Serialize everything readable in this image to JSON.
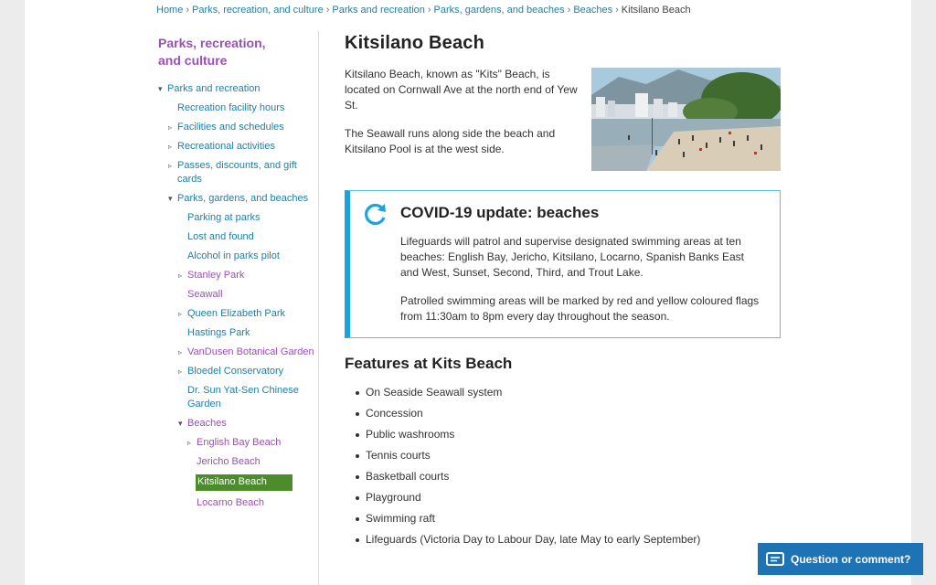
{
  "breadcrumb": [
    {
      "label": "Home",
      "link": true
    },
    {
      "label": "Parks, recreation, and culture",
      "link": true
    },
    {
      "label": "Parks and recreation",
      "link": true
    },
    {
      "label": "Parks, gardens, and beaches",
      "link": true
    },
    {
      "label": "Beaches",
      "link": true
    },
    {
      "label": "Kitsilano Beach",
      "link": false
    }
  ],
  "sidebar": {
    "title": "Parks, recreation, and culture",
    "items": [
      {
        "label": "Parks and recreation",
        "level": 1,
        "tri": "open"
      },
      {
        "label": "Recreation facility hours",
        "level": 2,
        "tri": ""
      },
      {
        "label": "Facilities and schedules",
        "level": 2,
        "tri": "closed"
      },
      {
        "label": "Recreational activities",
        "level": 2,
        "tri": "closed"
      },
      {
        "label": "Passes, discounts, and gift cards",
        "level": 2,
        "tri": "closed"
      },
      {
        "label": "Parks, gardens, and beaches",
        "level": 2,
        "tri": "open"
      },
      {
        "label": "Parking at parks",
        "level": 3,
        "tri": ""
      },
      {
        "label": "Lost and found",
        "level": 3,
        "tri": ""
      },
      {
        "label": "Alcohol in parks pilot",
        "level": 3,
        "tri": ""
      },
      {
        "label": "Stanley Park",
        "level": 3,
        "tri": "closed",
        "visited": true
      },
      {
        "label": "Seawall",
        "level": 3,
        "tri": "",
        "visited": true
      },
      {
        "label": "Queen Elizabeth Park",
        "level": 3,
        "tri": "closed"
      },
      {
        "label": "Hastings Park",
        "level": 3,
        "tri": ""
      },
      {
        "label": "VanDusen Botanical Garden",
        "level": 3,
        "tri": "closed",
        "visited": true
      },
      {
        "label": "Bloedel Conservatory",
        "level": 3,
        "tri": "closed"
      },
      {
        "label": "Dr. Sun Yat-Sen Chinese Garden",
        "level": 3,
        "tri": ""
      },
      {
        "label": "Beaches",
        "level": 3,
        "tri": "open",
        "visited": true
      },
      {
        "label": "English Bay Beach",
        "level": 4,
        "tri": "closed",
        "visited": true
      },
      {
        "label": "Jericho Beach",
        "level": 4,
        "tri": "",
        "visited": true
      },
      {
        "label": "Kitsilano Beach",
        "level": 4,
        "tri": "",
        "active": true
      },
      {
        "label": "Locarno Beach",
        "level": 4,
        "tri": "",
        "visited": true
      }
    ]
  },
  "main": {
    "title": "Kitsilano Beach",
    "intro": [
      "Kitsilano Beach, known as \"Kits\" Beach, is located on Cornwall Ave at the north end of Yew St.",
      "The Seawall runs along side the beach and Kitsilano Pool is at the west side."
    ],
    "covid": {
      "title": "COVID-19 update: beaches",
      "paragraphs": [
        "Lifeguards will patrol and supervise designated swimming areas at ten beaches: English Bay, Jericho, Kitsilano, Locarno, Spanish Banks East and West, Sunset, Second, Third, and Trout Lake.",
        "Patrolled swimming areas will be marked by red and yellow coloured flags from 11:30am to 8pm every day throughout the season."
      ]
    },
    "features_title": "Features at Kits Beach",
    "features": [
      "On Seaside Seawall system",
      "Concession",
      "Public washrooms",
      "Tennis courts",
      "Basketball courts",
      "Playground",
      "Swimming raft",
      "Lifeguards (Victoria Day to Labour Day, late May to early September)"
    ]
  },
  "feedback": {
    "label": "Question or comment?"
  },
  "colors": {
    "link": "#1e7fa8",
    "visited": "#9b4fb8",
    "active_bg": "#4c8c2b",
    "alert_border": "#1aa3dc",
    "feedback_bg": "#1e73b5"
  }
}
